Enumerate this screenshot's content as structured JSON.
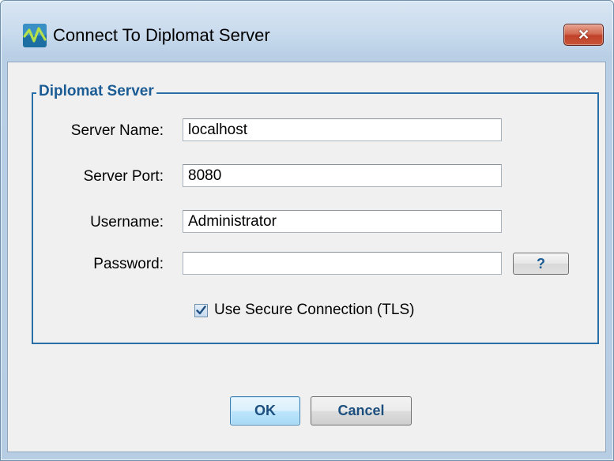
{
  "window": {
    "title": "Connect To Diplomat Server",
    "close_label": "✕"
  },
  "group": {
    "title": "Diplomat Server"
  },
  "form": {
    "server_name_label": "Server Name:",
    "server_name_value": "localhost",
    "server_port_label": "Server Port:",
    "server_port_value": "8080",
    "username_label": "Username:",
    "username_value": "Administrator",
    "password_label": "Password:",
    "password_value": "",
    "help_label": "?",
    "tls_label": "Use Secure Connection (TLS)",
    "tls_checked": true
  },
  "buttons": {
    "ok_label": "OK",
    "cancel_label": "Cancel"
  },
  "colors": {
    "accent": "#1c5c95",
    "group_border": "#2a6ea8",
    "close_red": "#c0412a"
  },
  "icons": {
    "app": "diplomat-app-icon",
    "close": "close-icon",
    "check": "checkmark-icon"
  }
}
